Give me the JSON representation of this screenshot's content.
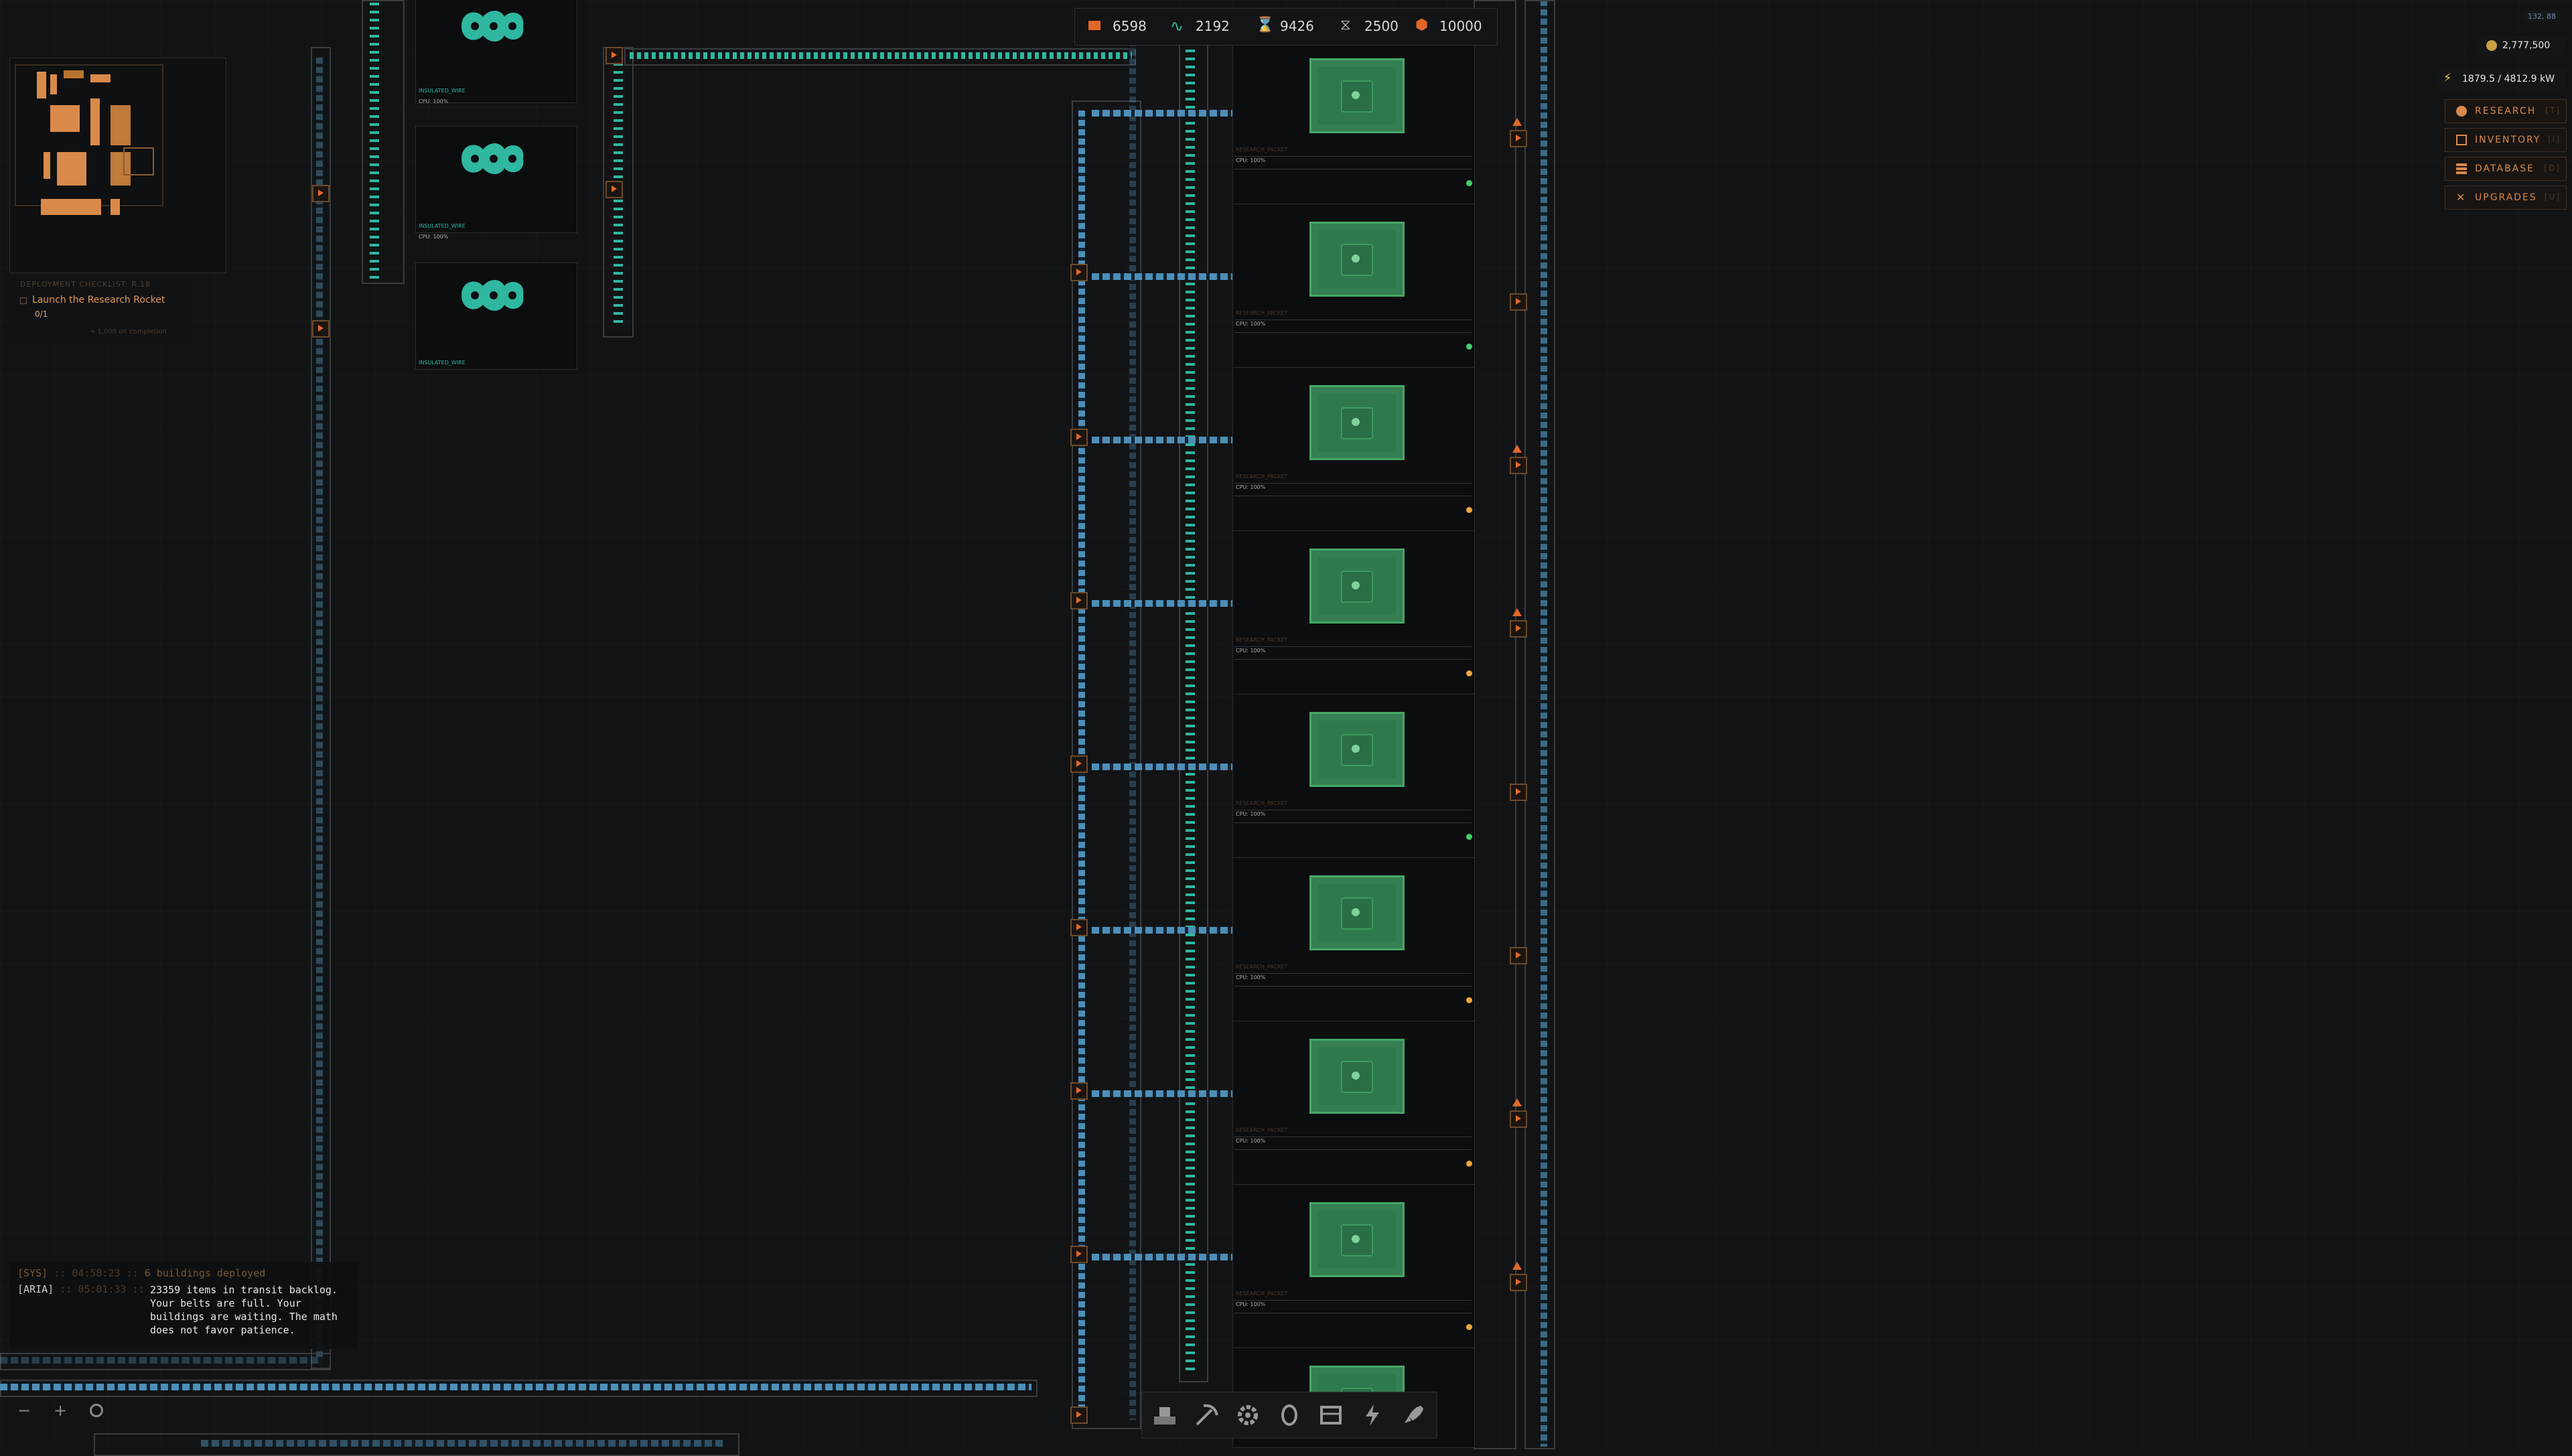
{
  "hud": {
    "resources": [
      {
        "icon": "ore-icon",
        "value": "6598"
      },
      {
        "icon": "wave-icon",
        "value": "2192"
      },
      {
        "icon": "hourglass-icon",
        "value": "9426"
      },
      {
        "icon": "spring-icon",
        "value": "2500"
      },
      {
        "icon": "cube-icon",
        "value": "10000"
      }
    ],
    "coords": "132, 88",
    "credits": "2,777,500",
    "power": "1879.5 / 4812.9 kW",
    "menu": [
      {
        "label": "RESEARCH",
        "key": "[T]",
        "icon": "research-icon"
      },
      {
        "label": "INVENTORY",
        "key": "[I]",
        "icon": "inventory-icon"
      },
      {
        "label": "DATABASE",
        "key": "[D]",
        "icon": "database-icon"
      },
      {
        "label": "UPGRADES",
        "key": "[U]",
        "icon": "upgrades-icon"
      }
    ]
  },
  "objective": {
    "header": "DEPLOYMENT CHECKLIST: R.18",
    "task": "Launch the Research Rocket",
    "progress": "0/1",
    "reward": "+ 1,000 on completion"
  },
  "log": [
    {
      "source": "[SYS]",
      "time": ":: 04:58:23 ::",
      "text": "6 buildings deployed"
    },
    {
      "source": "[ARIA]",
      "time": ":: 05:01:33 ::",
      "text": "23359 items in transit backlog. Your belts are full. Your buildings are waiting. The math does not favor patience."
    }
  ],
  "crafters": [
    {
      "label": "INSULATED_WIRE",
      "status": "CPU: 100%"
    },
    {
      "label": "INSULATED_WIRE",
      "status": "CPU: 100%"
    },
    {
      "label": "INSULATED_WIRE",
      "status": "CPU: 100%"
    }
  ],
  "buildings": [
    {
      "sub": "RESEARCH_PACKET",
      "status": "CPU: 100%",
      "state": "green"
    },
    {
      "sub": "RESEARCH_PACKET",
      "status": "CPU: 100%",
      "state": "green"
    },
    {
      "sub": "RESEARCH_PACKET",
      "status": "CPU: 100%",
      "state": "amber"
    },
    {
      "sub": "RESEARCH_PACKET",
      "status": "CPU: 100%",
      "state": "amber"
    },
    {
      "sub": "RESEARCH_PACKET",
      "status": "CPU: 100%",
      "state": "green"
    },
    {
      "sub": "RESEARCH_PACKET",
      "status": "CPU: 100%",
      "state": "amber"
    },
    {
      "sub": "RESEARCH_PACKET",
      "status": "CPU: 100%",
      "state": "amber"
    },
    {
      "sub": "RESEARCH_PACKET",
      "status": "CPU: 100%",
      "state": "amber"
    }
  ],
  "zoom": {
    "minus": "−",
    "plus": "+"
  },
  "toolbar": [
    "drill-icon",
    "pickaxe-icon",
    "gear-icon",
    "research-icon",
    "storage-icon",
    "power-icon",
    "rocket-icon"
  ],
  "colors": {
    "accent": "#d98a4a",
    "belt": "#4e8fb8",
    "cable": "#2fb7a0",
    "building": "#2e7a4d",
    "orange": "#e2682a"
  }
}
